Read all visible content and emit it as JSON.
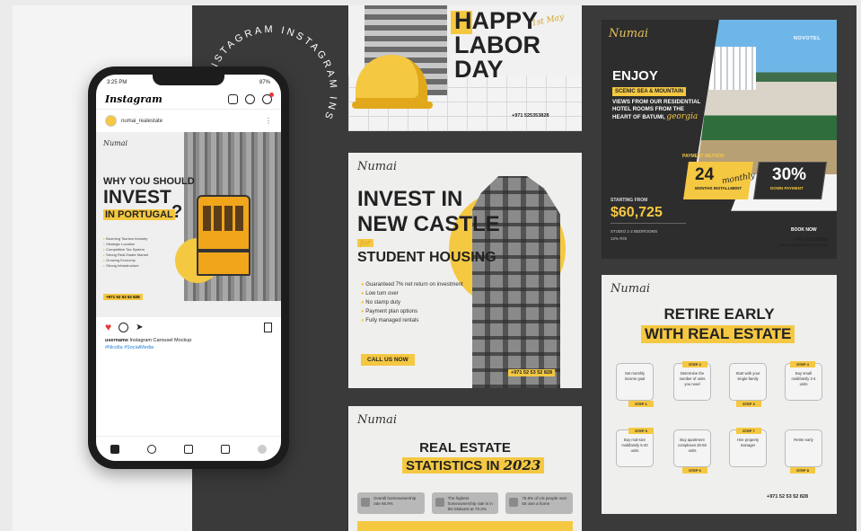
{
  "ring_text": "INSTAGRAM INSTAGRAM INS",
  "phone": {
    "status_time": "3:25 PM",
    "battery": "87%",
    "app_name": "Instagram",
    "username": "numai_realestate",
    "post": {
      "brand": "Numai",
      "line1": "WHY YOU SHOULD",
      "line2": "INVEST",
      "line3": "IN PORTUGAL",
      "qmark": "?",
      "bullets": [
        "Booming Tourism Industry",
        "Strategic Location",
        "Competitive Tax System",
        "Strong Real Estate Market",
        "Growing Economy",
        "Strong Infrastructure"
      ],
      "phone_tag": "+971 52 53 52 828"
    },
    "caption_user": "username",
    "caption_text": "Instagram Carousel Mockup",
    "caption_tags": "#Nicolla #SocialMedia"
  },
  "card_labor": {
    "happy": "HAPPY",
    "labor": "LABOR DAY",
    "date": "1st May",
    "phone": "+971 525353828"
  },
  "card_invest": {
    "brand": "Numai",
    "t1": "INVEST IN",
    "t2": "NEW CASTLE",
    "for": "for",
    "t3": "STUDENT HOUSING",
    "list": [
      "Guaranteed 7% net return on investment",
      "Low turn over",
      "No stamp duty",
      "Payment plan options",
      "Fully managed rentals"
    ],
    "cta": "CALL US NOW",
    "phone": "+971 52 53 52 828"
  },
  "card_stats": {
    "brand": "Numai",
    "t1": "REAL ESTATE",
    "t2": "STATISTICS IN",
    "year": "2023",
    "boxes": [
      "Overall homeownership rate 65.9%",
      "The highest homeownership rate is in the Midwest at 70.2%",
      "75.8% of US people over 65 own a home"
    ]
  },
  "card_batumi": {
    "brand": "Numai",
    "hotel": "NOVOTEL",
    "enjoy": "ENJOY",
    "scenic": "SCENIC SEA & MOUNTAIN",
    "views": "VIEWS FROM OUR RESIDENTIAL HOTEL ROOMS FROM THE HEART OF BATUMI,",
    "georgia": "georgia",
    "payment_method": "PAYMENT METHOD",
    "n24": "24",
    "months": "MONTHS INSTALLMENT",
    "monthly": "monthly",
    "n30": "30%",
    "down": "DOWN PAYMENT",
    "starting": "STARTING FROM",
    "price": "$60,725",
    "spec1": "STUDIO 1-2 BEDROOMS",
    "spec2": "12% ROI",
    "book": "BOOK NOW",
    "phone": "+971 525353828",
    "site": "WWW.NUMAIREALESTATE.COM"
  },
  "card_retire": {
    "brand": "Numai",
    "t1": "RETIRE EARLY",
    "t2": "WITH REAL ESTATE",
    "steps": [
      {
        "label": "STEP 1",
        "text": "Set monthly income goal"
      },
      {
        "label": "STEP 2",
        "text": "Determine the number of units you need"
      },
      {
        "label": "STEP 3",
        "text": "Start with your single-family"
      },
      {
        "label": "STEP 4",
        "text": "Buy small multifamily 2-4 units"
      },
      {
        "label": "STEP 5",
        "text": "Buy mid-size multifamily 5-20 units"
      },
      {
        "label": "STEP 6",
        "text": "Buy apartment complexes 20-50 units"
      },
      {
        "label": "STEP 7",
        "text": "Hire property manager"
      },
      {
        "label": "STEP 8",
        "text": "Retire early"
      }
    ],
    "phone": "+971 52 53 52 828"
  }
}
